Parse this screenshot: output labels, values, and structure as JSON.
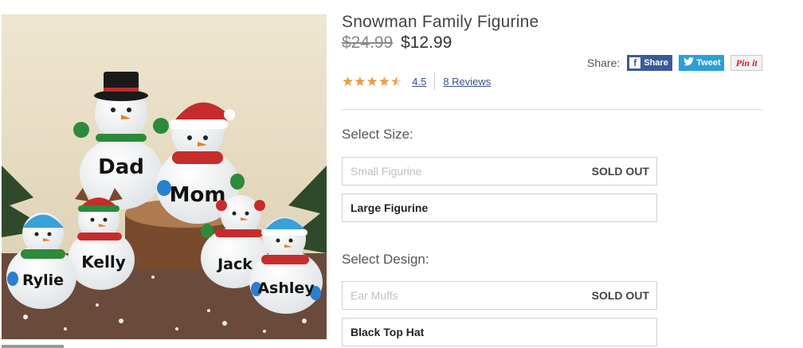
{
  "product": {
    "title": "Snowman Family Figurine",
    "old_price": "$24.99",
    "sale_price": "$12.99",
    "image_names": [
      "Dad",
      "Mom",
      "Kelly",
      "Jack",
      "Rylie",
      "Ashley"
    ]
  },
  "rating": {
    "stars": 4.5,
    "value": "4.5",
    "reviews_label": "8 Reviews"
  },
  "share": {
    "label": "Share:",
    "facebook_label": "Share",
    "twitter_label": "Tweet",
    "pinterest_label": "Pin it",
    "icons": [
      "facebook-icon",
      "twitter-icon",
      "pinterest-icon"
    ]
  },
  "options": {
    "size": {
      "label": "Select Size:",
      "items": [
        {
          "name": "Small Figurine",
          "status": "SOLD OUT"
        },
        {
          "name": "Large Figurine",
          "status": ""
        }
      ]
    },
    "design": {
      "label": "Select Design:",
      "items": [
        {
          "name": "Ear Muffs",
          "status": "SOLD OUT"
        },
        {
          "name": "Black Top Hat",
          "status": ""
        }
      ]
    }
  },
  "colors": {
    "star": "#f2993a",
    "link": "#35518a",
    "facebook": "#3b5a99",
    "twitter": "#2a9fd8",
    "pinterest": "#cb2027"
  }
}
